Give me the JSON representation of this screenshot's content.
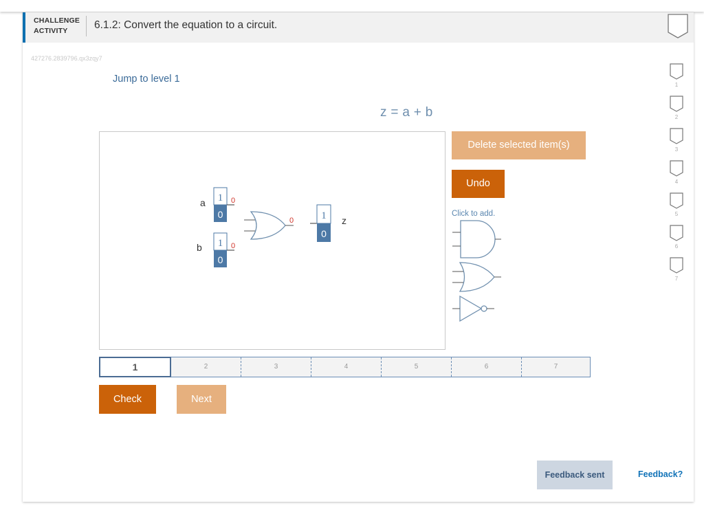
{
  "header": {
    "kind_line1": "CHALLENGE",
    "kind_line2": "ACTIVITY",
    "title": "6.1.2: Convert the equation to a circuit."
  },
  "activity_id": "427276.2839796.qx3zqy7",
  "jump_link": "Jump to level 1",
  "equation": "z = a + b",
  "circuit": {
    "input_a": {
      "label": "a",
      "top": "1",
      "bottom": "0",
      "value": "0"
    },
    "input_b": {
      "label": "b",
      "top": "1",
      "bottom": "0",
      "value": "0"
    },
    "or_gate_output_value": "0",
    "output_z": {
      "label": "z",
      "top": "1",
      "bottom": "0"
    }
  },
  "buttons": {
    "delete": "Delete selected item(s)",
    "undo": "Undo",
    "check": "Check",
    "next": "Next",
    "feedback_sent": "Feedback sent",
    "feedback_link": "Feedback?"
  },
  "palette": {
    "hint": "Click to add.",
    "gates": [
      "and-gate",
      "or-gate",
      "not-gate"
    ]
  },
  "levels": [
    "1",
    "2",
    "3",
    "4",
    "5",
    "6",
    "7"
  ],
  "active_level": "1",
  "side_badges": [
    "1",
    "2",
    "3",
    "4",
    "5",
    "6",
    "7"
  ],
  "colors": {
    "accent_orange": "#cb6209",
    "light_orange": "#e6b07e",
    "gate_blue": "#6f8fae",
    "toggle_blue": "#4d79a6",
    "value_red": "#d0352b",
    "link_blue": "#1173b8"
  }
}
